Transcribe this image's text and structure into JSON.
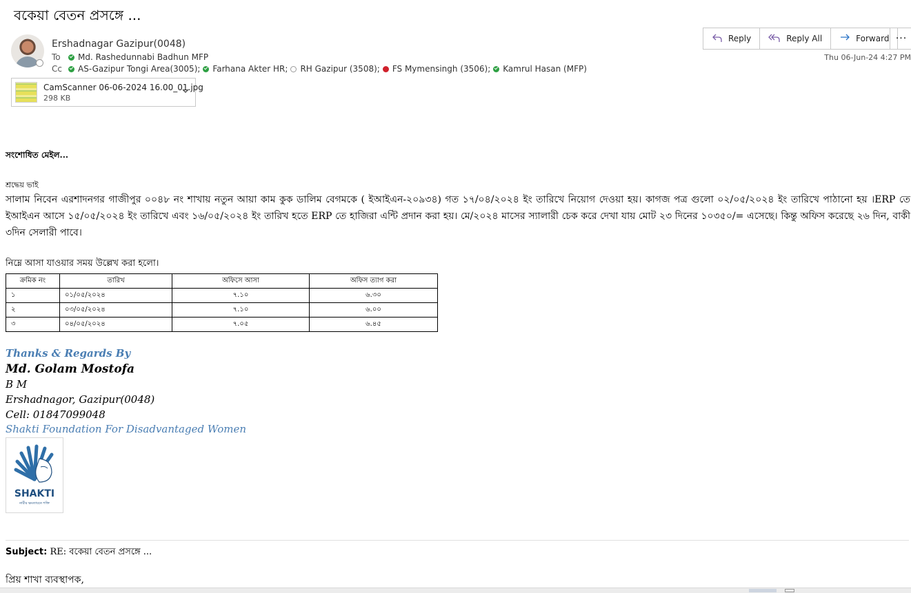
{
  "email": {
    "subject": "বকেয়া বেতন প্রসঙ্গে ...",
    "sender": "Ershadnagar Gazipur(0048)",
    "to_label": "To",
    "cc_label": "Cc",
    "to": [
      {
        "name": "Md. Rashedunnabi Badhun MFP",
        "status": "available"
      }
    ],
    "cc": [
      {
        "name": "AS-Gazipur Tongi Area(3005);",
        "status": "available"
      },
      {
        "name": "Farhana Akter HR;",
        "status": "available"
      },
      {
        "name": "RH Gazipur (3508);",
        "status": "offline"
      },
      {
        "name": "FS Mymensingh (3506);",
        "status": "busy"
      },
      {
        "name": "Kamrul Hasan (MFP)",
        "status": "available"
      }
    ],
    "datetime": "Thu 06-Jun-24 4:27 PM",
    "attachment": {
      "name": "CamScanner 06-06-2024 16.00_01.jpg",
      "size": "298 KB"
    }
  },
  "actions": {
    "reply": "Reply",
    "reply_all": "Reply All",
    "forward": "Forward",
    "more": "···"
  },
  "body": {
    "revised_note": "সংশোধিত মেইল...",
    "greeting": "শ্রদ্ধেয় ভাই",
    "paragraph": "সালাম নিবেন এরশাদনগর গাজীপুর ০০৪৮ নং শাখায় নতুন আয়া কাম কুক ডালিম বেগমকে ( ইআইএন-২০৯৩৪) গত ১৭/০৪/২০২৪ ইং তারিখে নিয়োগ দেওয়া হয়। কাগজ পত্র গুলো ০২/০৫/২০২৪ ইং তারিখে পাঠানো হয় ।ERP তে ইআইএন আসে ১৫/০৫/২০২৪ ইং তারিখে এবং ১৬/০৫/২০২৪ ইং তারিখ হতে ERP তে হাজিরা এন্টি প্রদান করা হয়। মে/২০২৪ মাসের স্যালারী চেক করে দেখা যায় মোট ২৩ দিনের ১০৩৫০/= এসেছে। কিন্তু অফিস করেছে ২৬ দিন, বাকী ৩দিন সেলারী পাবে।",
    "table_caption": "নিম্নে আসা যাওয়ার সময় উল্লেখ করা হলো।",
    "table": {
      "headers": [
        "ক্রমিক নং",
        "তারিখ",
        "অফিসে আসা",
        "অফিস ত্যাগ করা"
      ],
      "rows": [
        [
          "১",
          "০১/০৫/২০২৪",
          "৭.১০",
          "৬.৩০"
        ],
        [
          "২",
          "০৩/০৫/২০২৪",
          "৭.১০",
          "৬.০০"
        ],
        [
          "৩",
          "০৪/০৫/২০২৪",
          "৭.০৫",
          "৬.৪৫"
        ]
      ]
    }
  },
  "signature": {
    "thanks": "Thanks & Regards By",
    "name": "Md. Golam Mostofa",
    "title": "B M",
    "branch": "Ershadnagor, Gazipur(0048)",
    "cell": "Cell: 01847099048",
    "org": "Shakti Foundation For Disadvantaged Women",
    "logo_word": "SHAKTI",
    "logo_tag": "নারীর ক্ষমতায়নে শক্তি"
  },
  "quoted": {
    "subject_label": "Subject:",
    "subject_value": "RE: বকেয়া বেতন প্রসঙ্গে ...",
    "salutation": "প্রিয় শাখা ব্যবস্থাপক,"
  },
  "colors": {
    "available": "#2ea043",
    "busy": "#d0212c",
    "signature_blue": "#4a7eb3",
    "reply_icon": "#7a5ea8",
    "forward_icon": "#2b74c7"
  },
  "icons": {
    "reply": "reply-arrow-icon",
    "reply_all": "reply-all-arrow-icon",
    "forward": "forward-arrow-icon",
    "attachment_expand": "chevron-down-icon"
  }
}
